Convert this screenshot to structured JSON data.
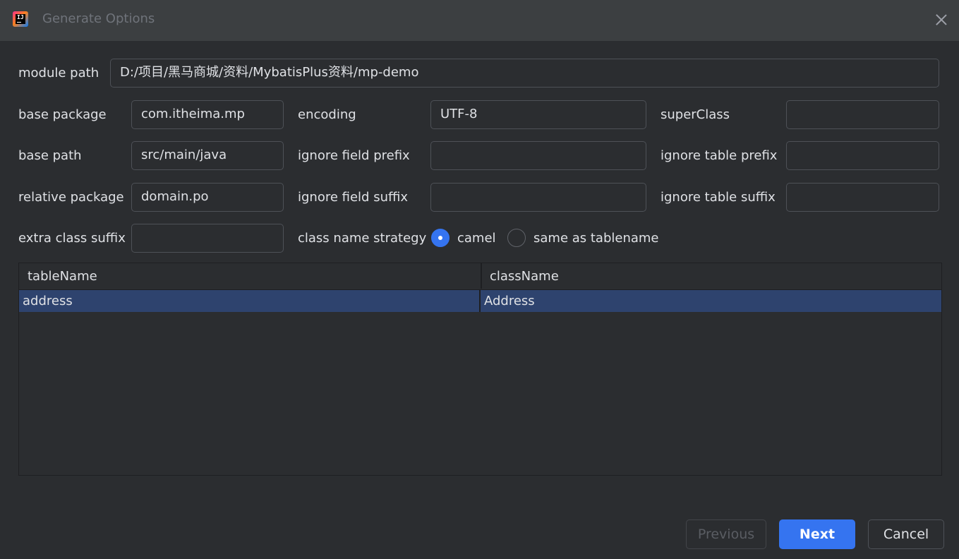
{
  "window": {
    "title": "Generate Options"
  },
  "form": {
    "module_path": {
      "label": "module path",
      "value": "D:/项目/黑马商城/资料/MybatisPlus资料/mp-demo"
    },
    "base_package": {
      "label": "base package",
      "value": "com.itheima.mp"
    },
    "base_path": {
      "label": "base path",
      "value": "src/main/java"
    },
    "relative_package": {
      "label": "relative package",
      "value": "domain.po"
    },
    "extra_class_suffix": {
      "label": "extra class suffix",
      "value": ""
    },
    "encoding": {
      "label": "encoding",
      "value": "UTF-8"
    },
    "ignore_field_prefix": {
      "label": "ignore field prefix",
      "value": ""
    },
    "ignore_field_suffix": {
      "label": "ignore field suffix",
      "value": ""
    },
    "super_class": {
      "label": "superClass",
      "value": ""
    },
    "ignore_table_prefix": {
      "label": "ignore table prefix",
      "value": ""
    },
    "ignore_table_suffix": {
      "label": "ignore table suffix",
      "value": ""
    },
    "class_name_strategy": {
      "label": "class name strategy",
      "options": [
        {
          "label": "camel",
          "selected": true
        },
        {
          "label": "same as tablename",
          "selected": false
        }
      ]
    }
  },
  "table": {
    "columns": [
      "tableName",
      "className"
    ],
    "rows": [
      {
        "tableName": "address",
        "className": "Address",
        "selected": true
      }
    ]
  },
  "buttons": {
    "previous": "Previous",
    "next": "Next",
    "cancel": "Cancel"
  },
  "colors": {
    "accent": "#3574f0",
    "background": "#2b2d30",
    "selection": "#2e436e"
  }
}
